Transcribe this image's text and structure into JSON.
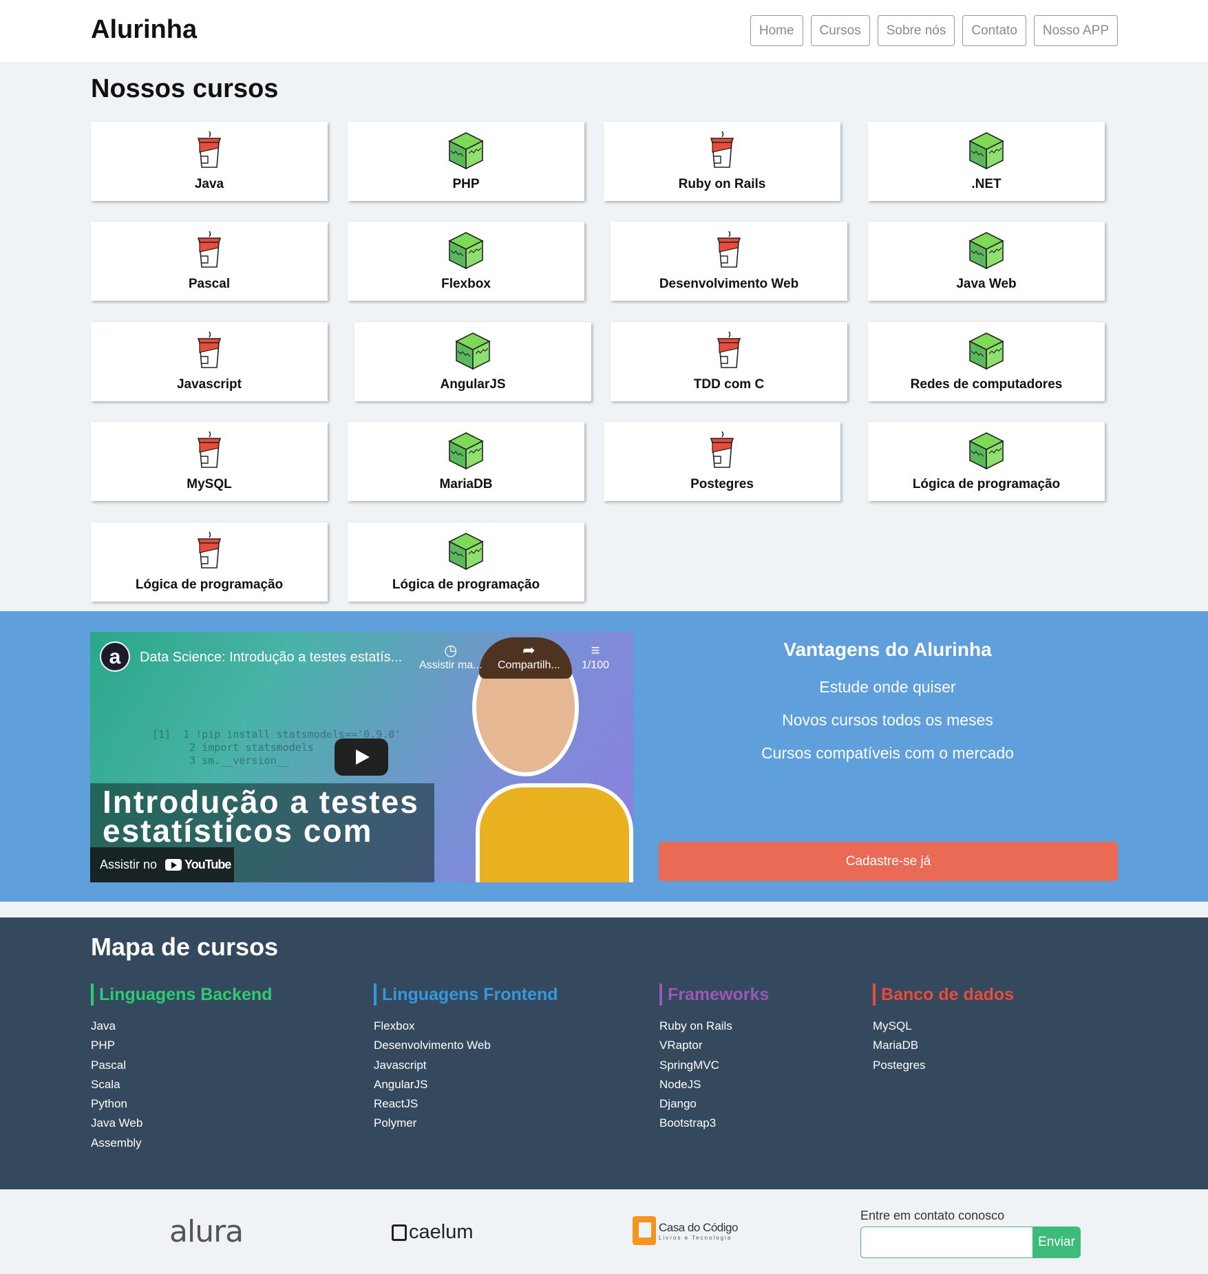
{
  "header": {
    "logo": "Alurinha",
    "nav": [
      "Home",
      "Cursos",
      "Sobre nós",
      "Contato",
      "Nosso APP"
    ]
  },
  "courses": {
    "title": "Nossos cursos",
    "items": [
      {
        "label": "Java",
        "icon": "cup-icon"
      },
      {
        "label": "PHP",
        "icon": "cube-icon"
      },
      {
        "label": "Ruby on Rails",
        "icon": "cup-icon"
      },
      {
        "label": ".NET",
        "icon": "cube-icon"
      },
      {
        "label": "Pascal",
        "icon": "cup-icon"
      },
      {
        "label": "Flexbox",
        "icon": "cube-icon"
      },
      {
        "label": "Desenvolvimento Web",
        "icon": "cup-icon"
      },
      {
        "label": "Java Web",
        "icon": "cube-icon"
      },
      {
        "label": "Javascript",
        "icon": "cup-icon"
      },
      {
        "label": "AngularJS",
        "icon": "cube-icon"
      },
      {
        "label": "TDD com C",
        "icon": "cup-icon"
      },
      {
        "label": "Redes de computadores",
        "icon": "cube-icon"
      },
      {
        "label": "MySQL",
        "icon": "cup-icon"
      },
      {
        "label": "MariaDB",
        "icon": "cube-icon"
      },
      {
        "label": "Postegres",
        "icon": "cup-icon"
      },
      {
        "label": "Lógica de programação",
        "icon": "cube-icon"
      },
      {
        "label": "Lógica de programação",
        "icon": "cup-icon"
      },
      {
        "label": "Lógica de programação",
        "icon": "cube-icon"
      }
    ]
  },
  "video": {
    "channel_letter": "a",
    "title": "Data Science: Introdução a testes estatís...",
    "watch_later": "Assistir ma...",
    "share": "Compartilh...",
    "playlist": "1/100",
    "overlay_text_1": "Introdução a testes",
    "overlay_text_2": "estatísticos com",
    "watch_on": "Assistir no",
    "youtube": "YouTube"
  },
  "advantages": {
    "title": "Vantagens do Alurinha",
    "items": [
      "Estude onde quiser",
      "Novos cursos todos os meses",
      "Cursos compatíveis com o mercado"
    ],
    "cta": "Cadastre-se já"
  },
  "map": {
    "title": "Mapa de cursos",
    "columns": [
      {
        "title": "Linguagens Backend",
        "color": "#2ecc71",
        "items": [
          "Java",
          "PHP",
          "Pascal",
          "Scala",
          "Python",
          "Java Web",
          "Assembly"
        ]
      },
      {
        "title": "Linguagens Frontend",
        "color": "#3498db",
        "items": [
          "Flexbox",
          "Desenvolvimento Web",
          "Javascript",
          "AngularJS",
          "ReactJS",
          "Polymer"
        ]
      },
      {
        "title": "Frameworks",
        "color": "#9b59b6",
        "items": [
          "Ruby on Rails",
          "VRaptor",
          "SpringMVC",
          "NodeJS",
          "Django",
          "Bootstrap3"
        ]
      },
      {
        "title": "Banco de dados",
        "color": "#e74c3c",
        "items": [
          "MySQL",
          "MariaDB",
          "Postegres"
        ]
      }
    ]
  },
  "footer": {
    "alura": "alura",
    "caelum": "caelum",
    "cdc_title": "Casa do Código",
    "cdc_sub": "Livros e Tecnologia",
    "contact_label": "Entre em contato conosco",
    "send": "Enviar"
  }
}
